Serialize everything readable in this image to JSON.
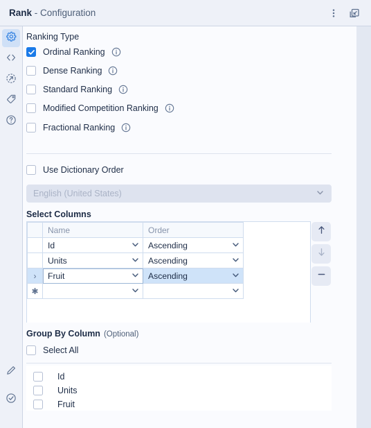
{
  "window": {
    "title_strong": "Rank",
    "title_rest": " - Configuration",
    "menu_icon": "more-vertical-icon",
    "expand_icon": "restore-window-icon"
  },
  "rail": {
    "top_items": [
      {
        "name": "gear-icon",
        "label": "Configuration",
        "active": true
      },
      {
        "name": "code-icon",
        "label": "Code",
        "active": false
      },
      {
        "name": "export-circle-icon",
        "label": "Export",
        "active": false
      },
      {
        "name": "tag-icon",
        "label": "Tags",
        "active": false
      },
      {
        "name": "help-circle-icon",
        "label": "Help",
        "active": false
      }
    ],
    "bottom_items": [
      {
        "name": "pencil-icon",
        "label": "Edit"
      },
      {
        "name": "check-circle-icon",
        "label": "Validate"
      }
    ]
  },
  "ranking_type": {
    "heading": "Ranking Type",
    "options": [
      {
        "label": "Ordinal Ranking",
        "checked": true,
        "info": "info-icon"
      },
      {
        "label": "Dense Ranking",
        "checked": false,
        "info": "info-icon"
      },
      {
        "label": "Standard Ranking",
        "checked": false,
        "info": "info-icon"
      },
      {
        "label": "Modified Competition Ranking",
        "checked": false,
        "info": "info-icon"
      },
      {
        "label": "Fractional Ranking",
        "checked": false,
        "info": "info-icon"
      }
    ]
  },
  "dictionary_order": {
    "checkbox_label": "Use Dictionary Order",
    "checked": false,
    "locale_value": "English (United States)",
    "locale_enabled": false,
    "chevron": "chevron-down-icon"
  },
  "select_columns": {
    "heading": "Select Columns",
    "headers": {
      "selector": "",
      "name": "Name",
      "order": "Order"
    },
    "rows": [
      {
        "marker": "",
        "name": "Id",
        "order": "Ascending",
        "selected": false
      },
      {
        "marker": "",
        "name": "Units",
        "order": "Ascending",
        "selected": false
      },
      {
        "marker": "›",
        "name": "Fruit",
        "order": "Ascending",
        "selected": true
      },
      {
        "marker": "✱",
        "name": "",
        "order": "",
        "selected": false
      }
    ],
    "buttons": [
      {
        "name": "move-up-button",
        "icon": "arrow-up-icon",
        "enabled": true
      },
      {
        "name": "move-down-button",
        "icon": "arrow-down-icon",
        "enabled": false
      },
      {
        "name": "remove-row-button",
        "icon": "minus-icon",
        "enabled": true
      }
    ]
  },
  "group_by": {
    "heading": "Group By Column",
    "optional_tag": "(Optional)",
    "select_all_label": "Select All",
    "select_all_checked": false,
    "columns": [
      {
        "label": "Id",
        "checked": false
      },
      {
        "label": "Units",
        "checked": false
      },
      {
        "label": "Fruit",
        "checked": false
      }
    ]
  },
  "colors": {
    "accent": "#1a7ae8",
    "titlebar": "#eef1f8",
    "panel": "#fafbfe",
    "row_selected": "#cfe3f9",
    "rail_active": "#cfe0f7"
  }
}
